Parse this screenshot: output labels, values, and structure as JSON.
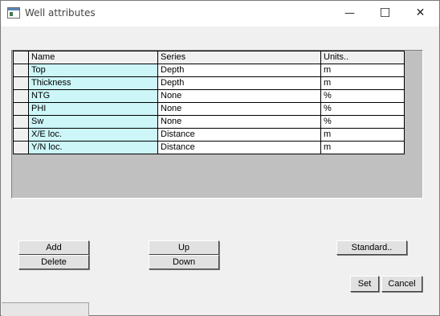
{
  "window": {
    "title": "Well attributes",
    "minimize_glyph": "—",
    "maximize_glyph": "☐",
    "close_glyph": "✕"
  },
  "table": {
    "headers": [
      "Name",
      "Series",
      "Units.."
    ],
    "rows": [
      {
        "name": "Top",
        "series": "Depth",
        "units": "m"
      },
      {
        "name": "Thickness",
        "series": "Depth",
        "units": "m"
      },
      {
        "name": "NTG",
        "series": "None",
        "units": "%"
      },
      {
        "name": "PHI",
        "series": "None",
        "units": "%"
      },
      {
        "name": "Sw",
        "series": "None",
        "units": "%"
      },
      {
        "name": "X/E loc.",
        "series": "Distance",
        "units": "m"
      },
      {
        "name": "Y/N loc.",
        "series": "Distance",
        "units": "m"
      }
    ],
    "name_column_color": "#ccf6f8"
  },
  "buttons": {
    "add": "Add",
    "delete": "Delete",
    "up": "Up",
    "down": "Down",
    "standard": "Standard..",
    "set": "Set",
    "cancel": "Cancel"
  }
}
